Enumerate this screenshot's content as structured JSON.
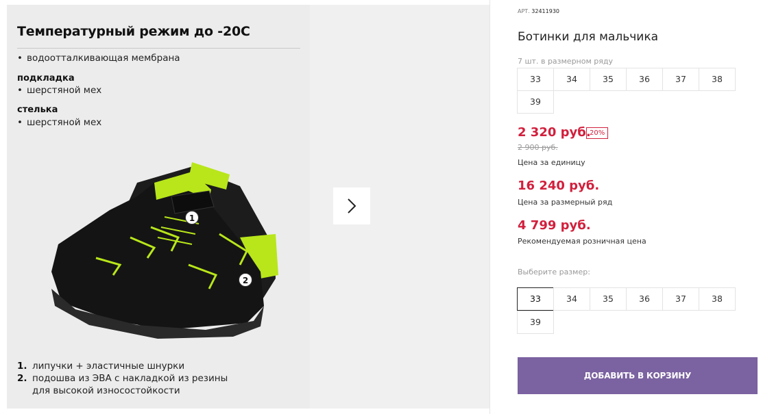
{
  "features": {
    "title": "Температурный режим до -20С",
    "membrane": "водоотталкивающая мембрана",
    "lining_heading": "подкладка",
    "lining_value": "шерстяной мех",
    "insole_heading": "стелька",
    "insole_value": "шерстяной мех",
    "bullet": "•"
  },
  "image_markers": [
    "1",
    "2"
  ],
  "notes": [
    {
      "num": "1.",
      "text": "липучки + эластичные шнурки"
    },
    {
      "num": "2.",
      "text": "подошва из ЭВА с накладкой из резины"
    },
    {
      "num": "",
      "text": "для высокой износостойкости"
    }
  ],
  "product": {
    "article_label": "АРТ.",
    "article_number": "32411930",
    "title": "Ботинки для мальчика",
    "row_count": "7 шт. в размерном ряду",
    "row_sizes": [
      "33",
      "34",
      "35",
      "36",
      "37",
      "38",
      "39"
    ]
  },
  "pricing": {
    "price_now": "2 320 руб.",
    "discount": "20%",
    "price_old": "2 900 руб.",
    "unit_caption": "Цена за единицу",
    "row_price": "16 240 руб.",
    "row_caption": "Цена за размерный ряд",
    "retail_price": "4 799 руб.",
    "retail_caption": "Рекомендуемая розничная цена"
  },
  "size_picker": {
    "label": "Выберите размер:",
    "sizes": [
      "33",
      "34",
      "35",
      "36",
      "37",
      "38",
      "39"
    ],
    "selected": "33"
  },
  "cart": {
    "add_label": "ДОБАВИТЬ В КОРЗИНУ"
  },
  "colors": {
    "price_red": "#d21f3c",
    "button_purple": "#7b62a0",
    "shoe_accent": "#b8e61a"
  },
  "icons": {
    "next": "chevron-right-icon"
  }
}
